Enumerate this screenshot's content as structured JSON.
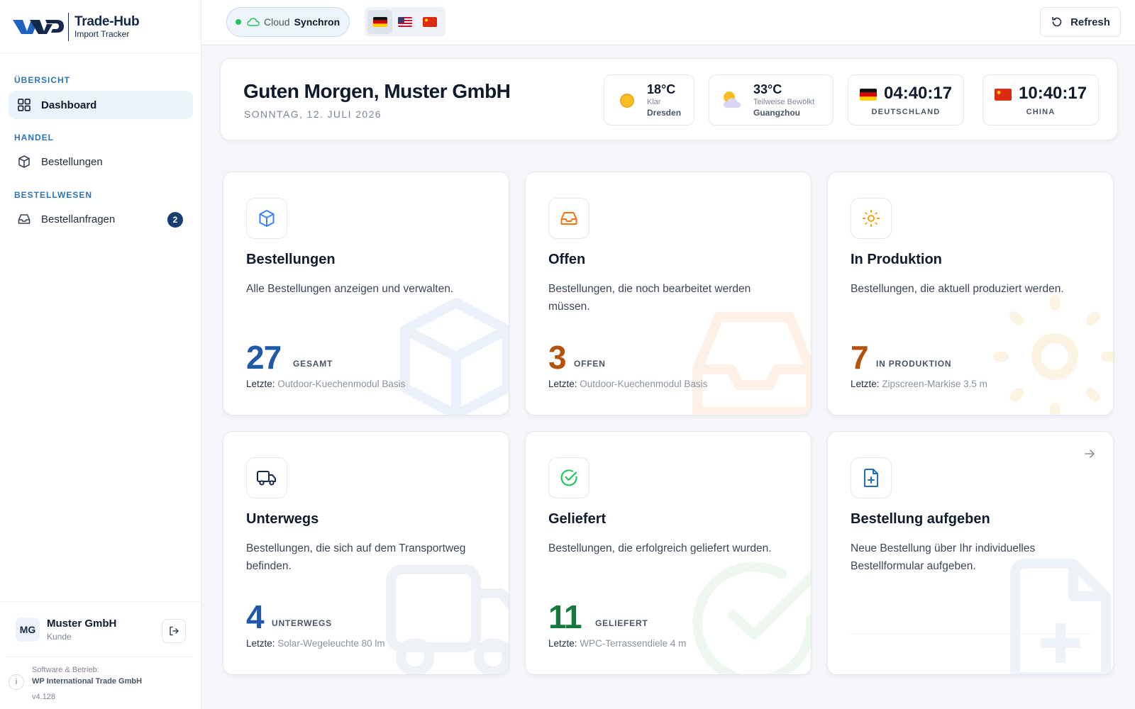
{
  "brand": {
    "title": "Trade-Hub",
    "subtitle": "Import Tracker"
  },
  "sidebar": {
    "sections": [
      {
        "label": "ÜBERSICHT"
      },
      {
        "label": "HANDEL"
      },
      {
        "label": "BESTELLWESEN"
      }
    ],
    "items": [
      {
        "label": "Dashboard",
        "icon": "grid-icon",
        "active": true
      },
      {
        "label": "Bestellungen",
        "icon": "package-icon"
      },
      {
        "label": "Bestellanfragen",
        "icon": "inbox-icon",
        "badge": "2"
      }
    ],
    "user": {
      "initials": "MG",
      "name": "Muster GmbH",
      "role": "Kunde"
    },
    "footer": {
      "label": "Software & Betrieb:",
      "company": "WP International Trade GmbH",
      "version": "v4.128"
    }
  },
  "topbar": {
    "cloud_label": "Cloud",
    "cloud_status": "Synchron",
    "languages": [
      "de",
      "us",
      "cn"
    ],
    "refresh_label": "Refresh"
  },
  "greeting": {
    "title": "Guten Morgen, Muster GmbH",
    "date": "SONNTAG, 12. JULI 2026",
    "weather": [
      {
        "temp": "18°C",
        "condition": "Klar",
        "city": "Dresden",
        "icon": "sun-icon"
      },
      {
        "temp": "33°C",
        "condition": "Teilweise Bewölkt",
        "city": "Guangzhou",
        "icon": "partly-cloudy-icon"
      }
    ],
    "clocks": [
      {
        "time": "04:40:17",
        "label": "DEUTSCHLAND"
      },
      {
        "time": "10:40:17",
        "label": "CHINA"
      }
    ]
  },
  "cards": [
    {
      "title": "Bestellungen",
      "desc": "Alle Bestellungen anzeigen und verwalten.",
      "count": "27",
      "count_label": "GESAMT",
      "last_label": "Letzte:",
      "last_value": "Outdoor-Kuechenmodul Basis",
      "color": "#1e5aa8",
      "icon": "package-icon"
    },
    {
      "title": "Offen",
      "desc": "Bestellungen, die noch bearbeitet werden müssen.",
      "count": "3",
      "count_label": "OFFEN",
      "last_label": "Letzte:",
      "last_value": "Outdoor-Kuechenmodul Basis",
      "color": "#b4530b",
      "icon": "inbox-icon"
    },
    {
      "title": "In Produktion",
      "desc": "Bestellungen, die aktuell produziert werden.",
      "count": "7",
      "count_label": "IN PRODUKTION",
      "last_label": "Letzte:",
      "last_value": "Zipscreen-Markise 3.5 m",
      "color": "#b4530b",
      "icon": "sun-icon"
    },
    {
      "title": "Unterwegs",
      "desc": "Bestellungen, die sich auf dem Transportweg befinden.",
      "count": "4",
      "count_label": "UNTERWEGS",
      "last_label": "Letzte:",
      "last_value": "Solar-Wegeleuchte 80 lm",
      "color": "#1e5aa8",
      "icon": "truck-icon"
    },
    {
      "title": "Geliefert",
      "desc": "Bestellungen, die erfolgreich geliefert wurden.",
      "count": "11",
      "count_label": "GELIEFERT",
      "last_label": "Letzte:",
      "last_value": "WPC-Terrassendiele 4 m",
      "color": "#157a3b",
      "icon": "check-circle-icon"
    },
    {
      "title": "Bestellung aufgeben",
      "desc": "Neue Bestellung über Ihr individuelles Bestellformular aufgeben.",
      "icon": "file-plus-icon"
    }
  ]
}
